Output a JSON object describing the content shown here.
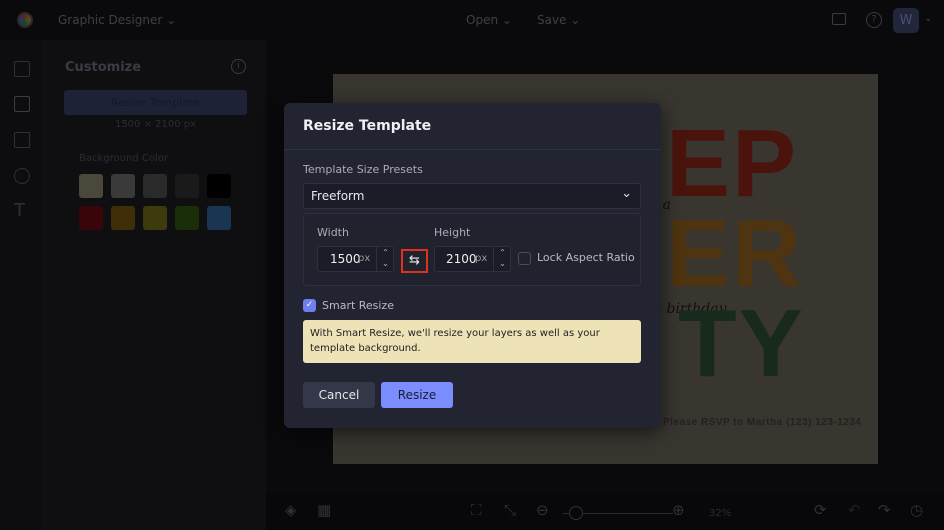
{
  "topbar": {
    "app_title": "Graphic Designer",
    "open_label": "Open",
    "save_label": "Save",
    "avatar_letter": "W"
  },
  "panel": {
    "title": "Customize",
    "resize_button": "Resize Template",
    "dimensions": "1500 × 2100 px",
    "bg_color_label": "Background Color",
    "swatches": [
      "#4a473b",
      "#3a3a3a",
      "#2a2a2a",
      "#1a1a1a",
      "#000000",
      "#3a0509",
      "#3f2e08",
      "#3d3a0c",
      "#1a2e0a",
      "#1a3552"
    ]
  },
  "canvas": {
    "line1": "EP",
    "line2": "ER",
    "line3": "TY",
    "script1": "s a",
    "script2": "'s birthday",
    "footer": "Please RSVP to Martha (123) 123-1234",
    "colors": {
      "bg": "#393630",
      "red": "#4a140c",
      "orange": "#4e3410",
      "green": "#172a1c"
    }
  },
  "bottombar": {
    "zoom": "32%",
    "zoom_level": 0.05
  },
  "modal": {
    "title": "Resize Template",
    "presets_label": "Template Size Presets",
    "preset_value": "Freeform",
    "width_label": "Width",
    "height_label": "Height",
    "width_value": "1500",
    "height_value": "2100",
    "unit": "px",
    "lock_label": "Lock Aspect Ratio",
    "lock_checked": false,
    "smart_label": "Smart Resize",
    "smart_checked": true,
    "info": "With Smart Resize, we'll resize your layers as well as your template background.",
    "cancel": "Cancel",
    "resize": "Resize",
    "accent": "#7b8cff",
    "highlight": "#e03020"
  }
}
